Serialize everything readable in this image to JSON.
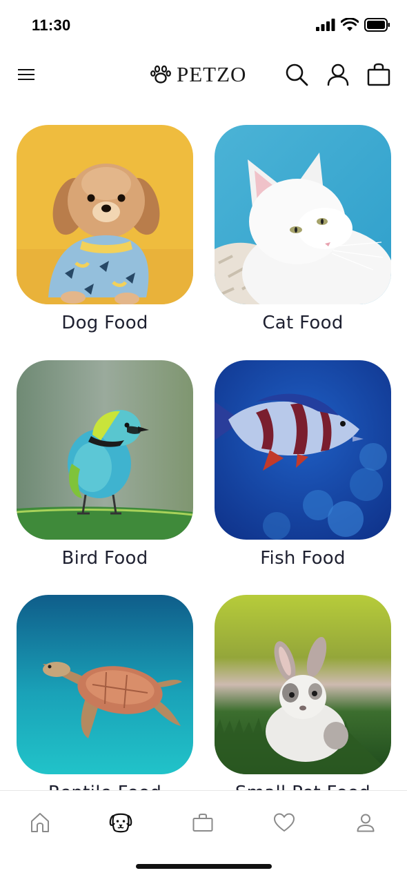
{
  "status_bar": {
    "time": "11:30"
  },
  "header": {
    "brand": "PETZO"
  },
  "categories": [
    {
      "label": "Dog Food"
    },
    {
      "label": "Cat Food"
    },
    {
      "label": "Bird Food"
    },
    {
      "label": "Fish Food"
    },
    {
      "label": "Reptile Food"
    },
    {
      "label": "Small Pet Food"
    }
  ],
  "bottom_nav": {
    "items": [
      {
        "icon": "home-icon"
      },
      {
        "icon": "dog-icon",
        "active": true
      },
      {
        "icon": "bag-icon"
      },
      {
        "icon": "heart-icon"
      },
      {
        "icon": "profile-icon"
      }
    ]
  },
  "colors": {
    "text": "#1a1a1a",
    "label": "#1e2030",
    "divider": "#e6e6e6"
  }
}
